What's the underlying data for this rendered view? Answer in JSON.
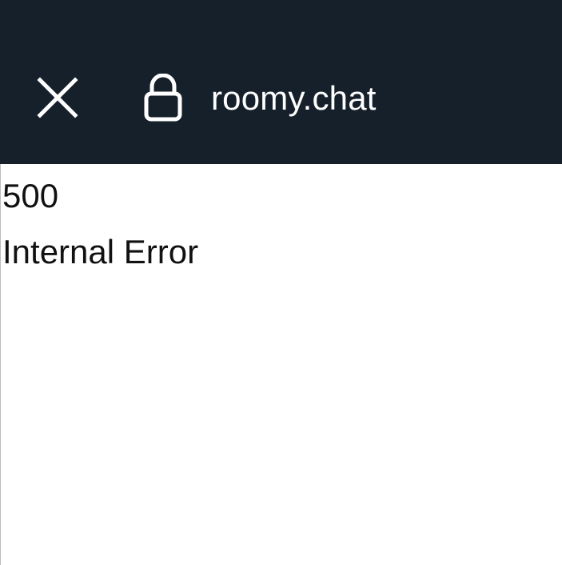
{
  "toolbar": {
    "url": "roomy.chat",
    "close_icon": "close-icon",
    "lock_icon": "lock-icon",
    "background_color": "#15202b"
  },
  "content": {
    "status_code": "500",
    "message": "Internal Error"
  }
}
